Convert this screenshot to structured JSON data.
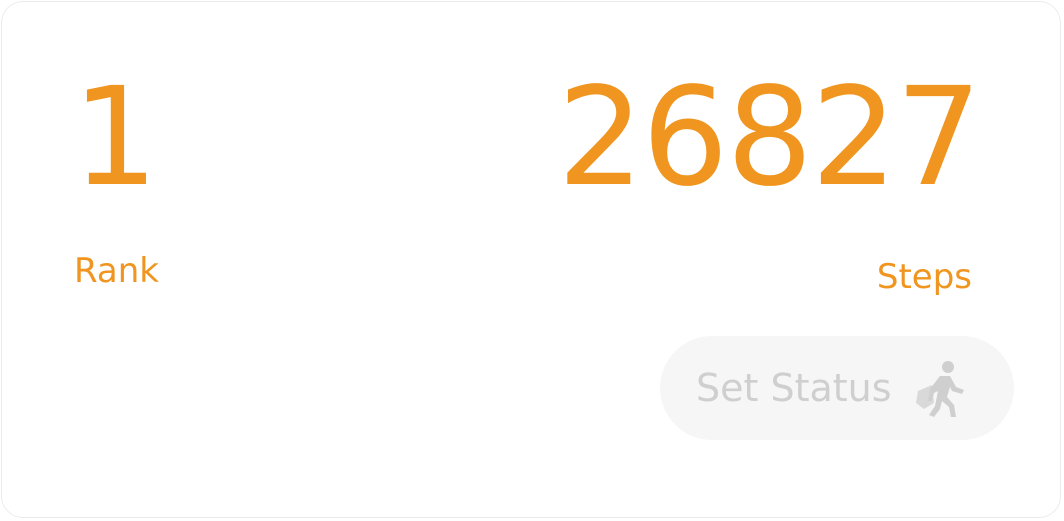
{
  "rank": {
    "value": "1",
    "label": "Rank"
  },
  "steps": {
    "value": "26827",
    "label": "Steps"
  },
  "status_button": {
    "label": "Set Status",
    "icon": "walking-person-icon"
  },
  "colors": {
    "accent": "#f0951f",
    "button_bg": "#f6f6f6",
    "button_text": "#cfcfcf"
  }
}
